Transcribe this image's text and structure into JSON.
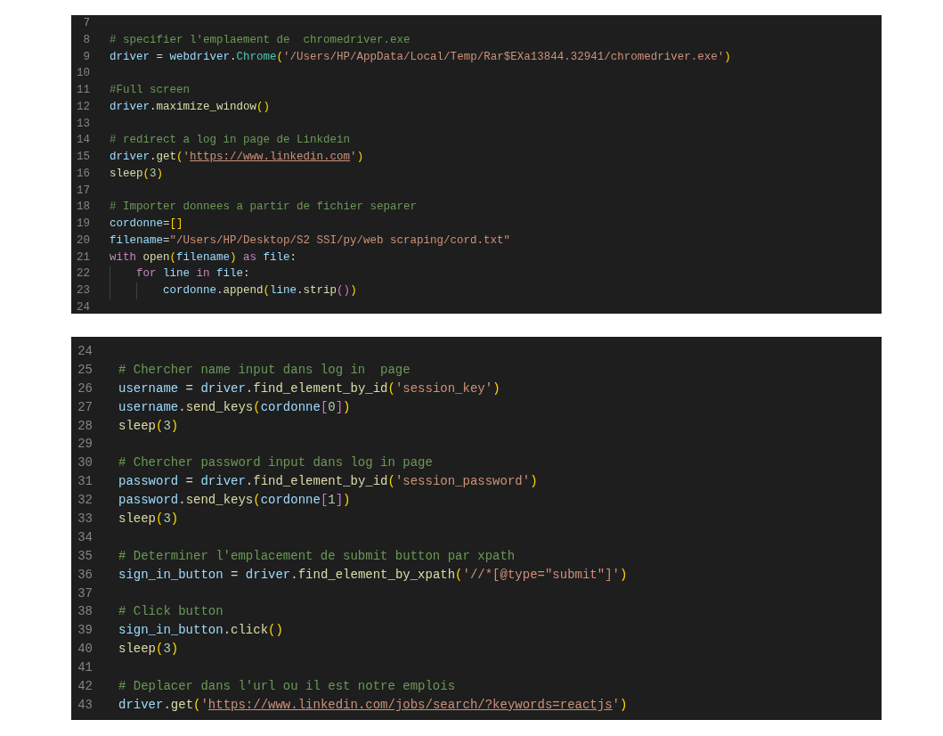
{
  "editors": [
    {
      "kind": "compact",
      "lines": [
        {
          "number": "7"
        },
        {
          "number": "8",
          "tokens": [
            {
              "kind": "comment",
              "text": "# specifier l'emplaement de  chromedriver.exe"
            }
          ]
        },
        {
          "number": "9",
          "tokens": [
            {
              "kind": "var",
              "text": "driver"
            },
            {
              "kind": "punct",
              "text": " = "
            },
            {
              "kind": "var",
              "text": "webdriver"
            },
            {
              "kind": "punct",
              "text": "."
            },
            {
              "kind": "class",
              "text": "Chrome"
            },
            {
              "kind": "bracket1",
              "text": "("
            },
            {
              "kind": "string",
              "text": "'/Users/HP/AppData/Local/Temp/Rar$EXa13844.32941/chromedriver.exe'"
            },
            {
              "kind": "bracket1",
              "text": ")"
            }
          ]
        },
        {
          "number": "10"
        },
        {
          "number": "11",
          "tokens": [
            {
              "kind": "comment",
              "text": "#Full screen"
            }
          ]
        },
        {
          "number": "12",
          "tokens": [
            {
              "kind": "var",
              "text": "driver"
            },
            {
              "kind": "punct",
              "text": "."
            },
            {
              "kind": "func",
              "text": "maximize_window"
            },
            {
              "kind": "bracket1",
              "text": "()"
            }
          ]
        },
        {
          "number": "13"
        },
        {
          "number": "14",
          "tokens": [
            {
              "kind": "comment",
              "text": "# redirect a log in page de Linkdein"
            }
          ]
        },
        {
          "number": "15",
          "tokens": [
            {
              "kind": "var",
              "text": "driver"
            },
            {
              "kind": "punct",
              "text": "."
            },
            {
              "kind": "func",
              "text": "get"
            },
            {
              "kind": "bracket1",
              "text": "("
            },
            {
              "kind": "string",
              "text": "'"
            },
            {
              "kind": "link",
              "text": "https://www.linkedin.com"
            },
            {
              "kind": "string",
              "text": "'"
            },
            {
              "kind": "bracket1",
              "text": ")"
            }
          ]
        },
        {
          "number": "16",
          "tokens": [
            {
              "kind": "func",
              "text": "sleep"
            },
            {
              "kind": "bracket1",
              "text": "("
            },
            {
              "kind": "number",
              "text": "3"
            },
            {
              "kind": "bracket1",
              "text": ")"
            }
          ]
        },
        {
          "number": "17"
        },
        {
          "number": "18",
          "tokens": [
            {
              "kind": "comment",
              "text": "# Importer donnees a partir de fichier separer"
            }
          ]
        },
        {
          "number": "19",
          "tokens": [
            {
              "kind": "var",
              "text": "cordonne"
            },
            {
              "kind": "punct",
              "text": "="
            },
            {
              "kind": "bracket1",
              "text": "[]"
            }
          ]
        },
        {
          "number": "20",
          "tokens": [
            {
              "kind": "var",
              "text": "filename"
            },
            {
              "kind": "punct",
              "text": "="
            },
            {
              "kind": "string",
              "text": "\"/Users/HP/Desktop/S2 SSI/py/web scraping/cord.txt\""
            }
          ]
        },
        {
          "number": "21",
          "tokens": [
            {
              "kind": "keyword",
              "text": "with "
            },
            {
              "kind": "func",
              "text": "open"
            },
            {
              "kind": "bracket1",
              "text": "("
            },
            {
              "kind": "var",
              "text": "filename"
            },
            {
              "kind": "bracket1",
              "text": ")"
            },
            {
              "kind": "keyword",
              "text": " as "
            },
            {
              "kind": "var",
              "text": "file"
            },
            {
              "kind": "punct",
              "text": ":"
            }
          ],
          "children": [
            {
              "number": "22",
              "tokens": [
                {
                  "kind": "keyword",
                  "text": "for "
                },
                {
                  "kind": "var",
                  "text": "line"
                },
                {
                  "kind": "keyword",
                  "text": " in "
                },
                {
                  "kind": "var",
                  "text": "file"
                },
                {
                  "kind": "punct",
                  "text": ":"
                }
              ],
              "children": [
                {
                  "number": "23",
                  "tokens": [
                    {
                      "kind": "var",
                      "text": "cordonne"
                    },
                    {
                      "kind": "punct",
                      "text": "."
                    },
                    {
                      "kind": "func",
                      "text": "append"
                    },
                    {
                      "kind": "bracket1",
                      "text": "("
                    },
                    {
                      "kind": "var",
                      "text": "line"
                    },
                    {
                      "kind": "punct",
                      "text": "."
                    },
                    {
                      "kind": "func",
                      "text": "strip"
                    },
                    {
                      "kind": "bracket2",
                      "text": "()"
                    },
                    {
                      "kind": "bracket1",
                      "text": ")"
                    }
                  ]
                }
              ]
            }
          ]
        },
        {
          "number": "24"
        }
      ]
    },
    {
      "kind": "zoomed",
      "lines": [
        {
          "number": "24"
        },
        {
          "number": "25",
          "tokens": [
            {
              "kind": "comment",
              "text": "# Chercher name input dans log in  page"
            }
          ]
        },
        {
          "number": "26",
          "tokens": [
            {
              "kind": "var",
              "text": "username"
            },
            {
              "kind": "punct",
              "text": " = "
            },
            {
              "kind": "var",
              "text": "driver"
            },
            {
              "kind": "punct",
              "text": "."
            },
            {
              "kind": "func",
              "text": "find_element_by_id"
            },
            {
              "kind": "bracket1",
              "text": "("
            },
            {
              "kind": "string",
              "text": "'session_key'"
            },
            {
              "kind": "bracket1",
              "text": ")"
            }
          ]
        },
        {
          "number": "27",
          "tokens": [
            {
              "kind": "var",
              "text": "username"
            },
            {
              "kind": "punct",
              "text": "."
            },
            {
              "kind": "func",
              "text": "send_keys"
            },
            {
              "kind": "bracket1",
              "text": "("
            },
            {
              "kind": "var",
              "text": "cordonne"
            },
            {
              "kind": "bracket2",
              "text": "["
            },
            {
              "kind": "number",
              "text": "0"
            },
            {
              "kind": "bracket2",
              "text": "]"
            },
            {
              "kind": "bracket1",
              "text": ")"
            }
          ]
        },
        {
          "number": "28",
          "tokens": [
            {
              "kind": "func",
              "text": "sleep"
            },
            {
              "kind": "bracket1",
              "text": "("
            },
            {
              "kind": "number",
              "text": "3"
            },
            {
              "kind": "bracket1",
              "text": ")"
            }
          ]
        },
        {
          "number": "29"
        },
        {
          "number": "30",
          "tokens": [
            {
              "kind": "comment",
              "text": "# Chercher password input dans log in page"
            }
          ]
        },
        {
          "number": "31",
          "tokens": [
            {
              "kind": "var",
              "text": "password"
            },
            {
              "kind": "punct",
              "text": " = "
            },
            {
              "kind": "var",
              "text": "driver"
            },
            {
              "kind": "punct",
              "text": "."
            },
            {
              "kind": "func",
              "text": "find_element_by_id"
            },
            {
              "kind": "bracket1",
              "text": "("
            },
            {
              "kind": "string",
              "text": "'session_password'"
            },
            {
              "kind": "bracket1",
              "text": ")"
            }
          ]
        },
        {
          "number": "32",
          "tokens": [
            {
              "kind": "var",
              "text": "password"
            },
            {
              "kind": "punct",
              "text": "."
            },
            {
              "kind": "func",
              "text": "send_keys"
            },
            {
              "kind": "bracket1",
              "text": "("
            },
            {
              "kind": "var",
              "text": "cordonne"
            },
            {
              "kind": "bracket2",
              "text": "["
            },
            {
              "kind": "number",
              "text": "1"
            },
            {
              "kind": "bracket2",
              "text": "]"
            },
            {
              "kind": "bracket1",
              "text": ")"
            }
          ]
        },
        {
          "number": "33",
          "tokens": [
            {
              "kind": "func",
              "text": "sleep"
            },
            {
              "kind": "bracket1",
              "text": "("
            },
            {
              "kind": "number",
              "text": "3"
            },
            {
              "kind": "bracket1",
              "text": ")"
            }
          ]
        },
        {
          "number": "34"
        },
        {
          "number": "35",
          "tokens": [
            {
              "kind": "comment",
              "text": "# Determiner l'emplacement de submit button par xpath"
            }
          ]
        },
        {
          "number": "36",
          "tokens": [
            {
              "kind": "var",
              "text": "sign_in_button"
            },
            {
              "kind": "punct",
              "text": " = "
            },
            {
              "kind": "var",
              "text": "driver"
            },
            {
              "kind": "punct",
              "text": "."
            },
            {
              "kind": "func",
              "text": "find_element_by_xpath"
            },
            {
              "kind": "bracket1",
              "text": "("
            },
            {
              "kind": "string",
              "text": "'//*[@type=\"submit\"]'"
            },
            {
              "kind": "bracket1",
              "text": ")"
            }
          ]
        },
        {
          "number": "37"
        },
        {
          "number": "38",
          "tokens": [
            {
              "kind": "comment",
              "text": "# Click button"
            }
          ]
        },
        {
          "number": "39",
          "tokens": [
            {
              "kind": "var",
              "text": "sign_in_button"
            },
            {
              "kind": "punct",
              "text": "."
            },
            {
              "kind": "func",
              "text": "click"
            },
            {
              "kind": "bracket1",
              "text": "()"
            }
          ]
        },
        {
          "number": "40",
          "tokens": [
            {
              "kind": "func",
              "text": "sleep"
            },
            {
              "kind": "bracket1",
              "text": "("
            },
            {
              "kind": "number",
              "text": "3"
            },
            {
              "kind": "bracket1",
              "text": ")"
            }
          ]
        },
        {
          "number": "41"
        },
        {
          "number": "42",
          "tokens": [
            {
              "kind": "comment",
              "text": "# Deplacer dans l'url ou il est notre emplois"
            }
          ]
        },
        {
          "number": "43",
          "tokens": [
            {
              "kind": "var",
              "text": "driver"
            },
            {
              "kind": "punct",
              "text": "."
            },
            {
              "kind": "func",
              "text": "get"
            },
            {
              "kind": "bracket1",
              "text": "("
            },
            {
              "kind": "string",
              "text": "'"
            },
            {
              "kind": "link",
              "text": "https://www.linkedin.com/jobs/search/?keywords=reactjs"
            },
            {
              "kind": "string",
              "text": "'"
            },
            {
              "kind": "bracket1",
              "text": ")"
            }
          ]
        }
      ]
    }
  ]
}
